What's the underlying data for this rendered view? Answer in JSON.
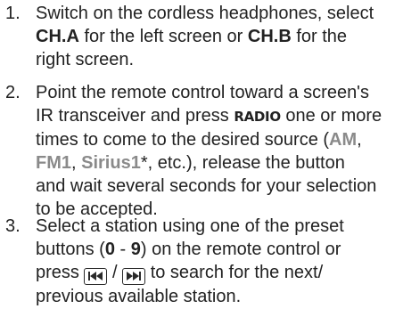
{
  "steps": [
    {
      "number": "1.",
      "lines": [
        {
          "pre": "Switch on the cordless headphones, select"
        },
        {
          "ch_a": "CH.A",
          "mid": " for the left screen or ",
          "ch_b": "CH.B",
          "post": " for the"
        },
        {
          "text": "right screen."
        }
      ]
    },
    {
      "number": "2.",
      "lines": [
        {
          "text": "Point the remote control toward a screen's"
        },
        {
          "pre": "IR transceiver and press ",
          "radio": "RADIO",
          "post": " one or more"
        },
        {
          "text": "times to come to the desired source ("
        },
        {
          "fm1": "FM1",
          "sep1": ", ",
          "sirius": "Sirius1",
          "post": "*, etc.), release the button"
        },
        {
          "text": "and wait several seconds for your selection"
        },
        {
          "text": "to be accepted."
        }
      ],
      "am": "AM",
      "am_post": ","
    },
    {
      "number": "3.",
      "lines": [
        {
          "text": "Select a station using one of the preset"
        },
        {
          "pre": "buttons (",
          "range_start": "0",
          "dash": " - ",
          "range_end": "9",
          "post": ") on the remote control or"
        },
        {
          "pre": "press ",
          "slash": " / ",
          "post": " to search for the next/"
        },
        {
          "text": "previous available station."
        }
      ]
    }
  ],
  "icons": {
    "prev": "skip-back-icon",
    "next": "skip-forward-icon"
  }
}
